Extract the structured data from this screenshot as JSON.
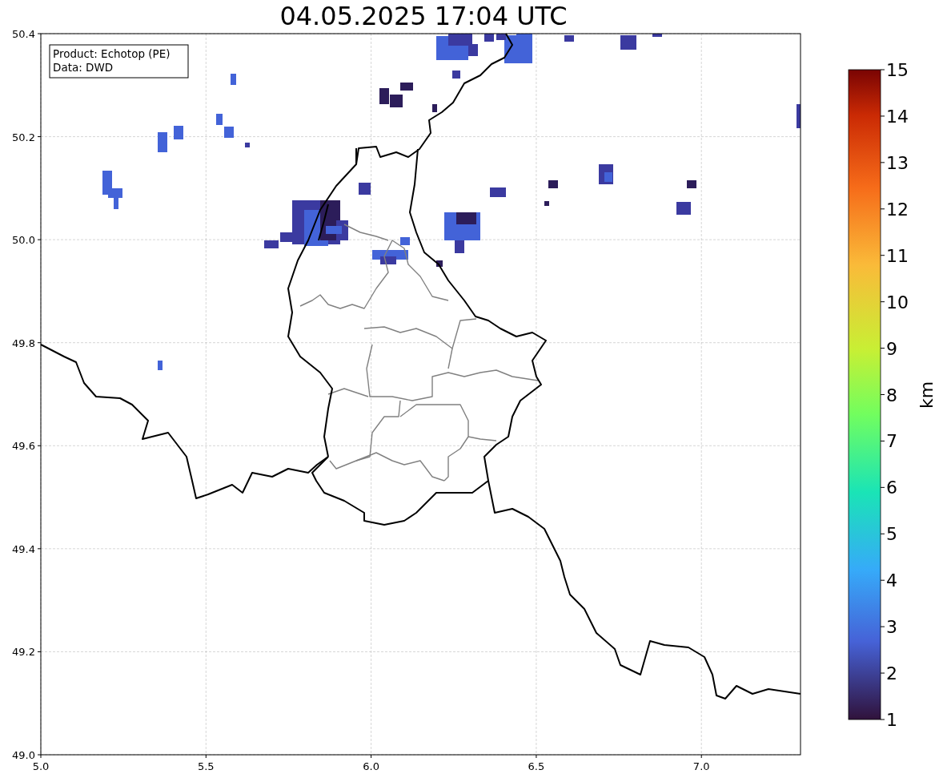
{
  "title": "04.05.2025 17:04 UTC",
  "info_box": {
    "lines": [
      "Product: Echotop (PE)",
      "Data: DWD"
    ]
  },
  "x_ticks": [
    "5.0",
    "5.5",
    "6.0",
    "6.5",
    "7.0"
  ],
  "y_ticks": [
    "50.4",
    "50.2",
    "50.0",
    "49.8",
    "49.6",
    "49.4",
    "49.2",
    "49.0"
  ],
  "colorbar": {
    "label": "km",
    "ticks": [
      "15",
      "14",
      "13",
      "12",
      "11",
      "10",
      "9",
      "8",
      "7",
      "6",
      "5",
      "4",
      "3",
      "2",
      "1"
    ]
  }
}
